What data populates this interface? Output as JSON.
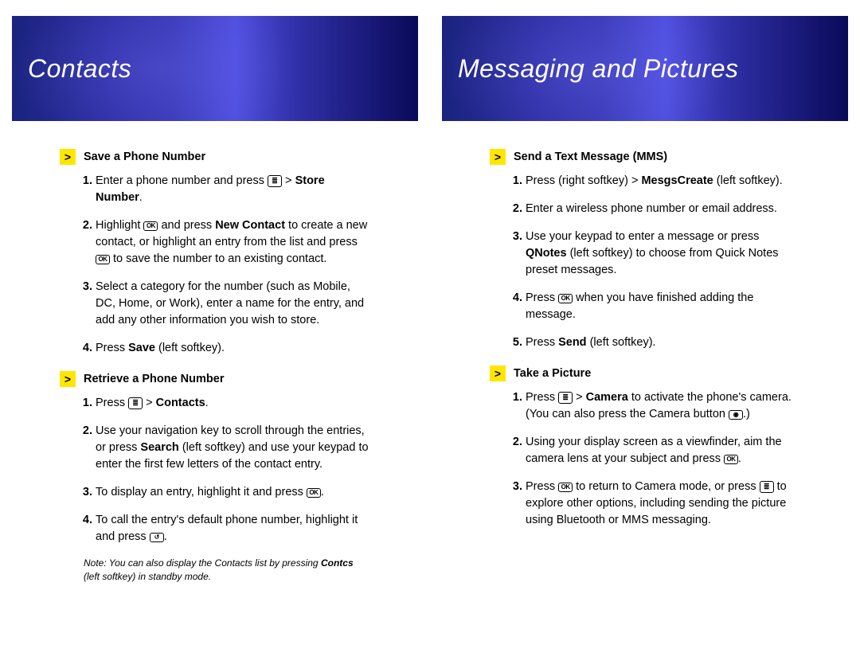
{
  "icons": {
    "menu": "≣",
    "ok": "OK",
    "call": "↺",
    "camera": "◉"
  },
  "left": {
    "banner": "Contacts",
    "sections": [
      {
        "title": "Save a Phone Number",
        "steps": [
          {
            "pre": "Enter a phone number and press ",
            "icon": "menu",
            "mid": " > ",
            "bold1": "Store Number",
            "post": "."
          },
          {
            "pre": "Highlight ",
            "bold1": "New Contact",
            "mid": " and press ",
            "icon": "ok",
            "mid2": " to create a new contact, or highlight an entry from the list and press ",
            "icon2": "ok",
            "post": " to save the number to an existing contact."
          },
          {
            "pre": "Select a category for the number (such as Mobile, DC, Home, or Work), enter a name for the entry, and add any other information you wish to store."
          },
          {
            "pre": "Press ",
            "bold1": "Save",
            "post": " (left softkey)."
          }
        ]
      },
      {
        "title": "Retrieve a Phone Number",
        "steps": [
          {
            "pre": "Press ",
            "icon": "menu",
            "mid": " > ",
            "bold1": "Contacts",
            "post": "."
          },
          {
            "pre": "Use your navigation key to scroll through the entries, or press ",
            "bold1": "Search",
            "post": " (left softkey) and use your keypad to enter the first few letters of the contact entry."
          },
          {
            "pre": "To display an entry, highlight it and press ",
            "icon": "ok",
            "post": "."
          },
          {
            "pre": "To call the entry's default phone number, highlight it and press ",
            "icon": "call",
            "post": "."
          }
        ],
        "note_pre": "Note: You can also display the Contacts list by pressing ",
        "note_bold": "Contcs",
        "note_post": " (left softkey) in standby mode."
      }
    ]
  },
  "right": {
    "banner": "Messaging and Pictures",
    "sections": [
      {
        "title": "Send a Text Message (MMS)",
        "steps": [
          {
            "pre": "Press ",
            "bold1": "Mesgs",
            "mid": " (right softkey) > ",
            "bold2": "Create",
            "post": " (left softkey)."
          },
          {
            "pre": "Enter a wireless phone number or email address."
          },
          {
            "pre": "Use your keypad to enter a message or press ",
            "bold1": "QNotes",
            "post": " (left softkey) to choose from Quick Notes preset messages."
          },
          {
            "pre": "Press ",
            "icon": "ok",
            "post": " when you have finished adding the message."
          },
          {
            "pre": "Press ",
            "bold1": "Send",
            "post": " (left softkey)."
          }
        ]
      },
      {
        "title": "Take a Picture",
        "steps": [
          {
            "pre": "Press ",
            "icon": "menu",
            "mid": " > ",
            "bold1": "Camera",
            "mid2": " to activate the phone's camera. (You can also press the Camera button ",
            "icon2": "camera",
            "post": ".)"
          },
          {
            "pre": "Using your display screen as a viewfinder, aim the camera lens at your subject and press ",
            "icon": "ok",
            "post": "."
          },
          {
            "pre": "Press ",
            "icon": "ok",
            "mid": " to return to Camera mode, or press ",
            "icon2": "menu",
            "post": " to explore other options, including sending the picture using Bluetooth or MMS messaging."
          }
        ]
      }
    ]
  }
}
